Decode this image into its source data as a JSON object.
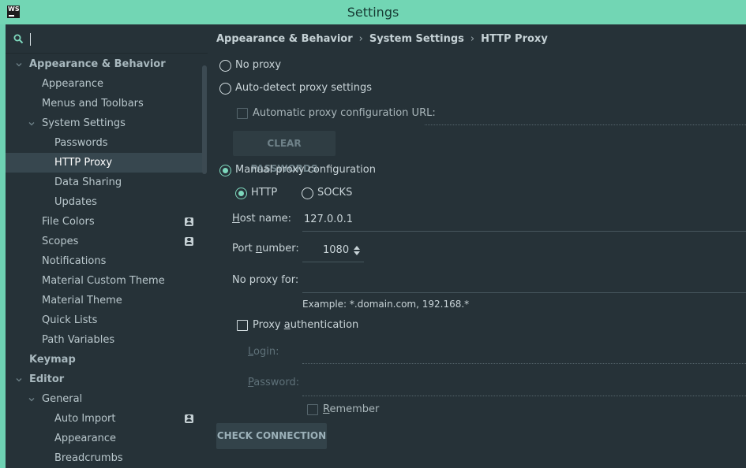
{
  "window": {
    "app_icon_text": "WS",
    "title": "Settings"
  },
  "sidebar": {
    "search": {
      "value": "",
      "placeholder": ""
    },
    "items": [
      {
        "label": "Appearance & Behavior",
        "level": 0,
        "expanded": true,
        "bold": true
      },
      {
        "label": "Appearance",
        "level": 1
      },
      {
        "label": "Menus and Toolbars",
        "level": 1
      },
      {
        "label": "System Settings",
        "level": 1,
        "expanded": true
      },
      {
        "label": "Passwords",
        "level": 2
      },
      {
        "label": "HTTP Proxy",
        "level": 2,
        "selected": true
      },
      {
        "label": "Data Sharing",
        "level": 2
      },
      {
        "label": "Updates",
        "level": 2
      },
      {
        "label": "File Colors",
        "level": 1,
        "project_icon": true
      },
      {
        "label": "Scopes",
        "level": 1,
        "project_icon": true
      },
      {
        "label": "Notifications",
        "level": 1
      },
      {
        "label": "Material Custom Theme",
        "level": 1
      },
      {
        "label": "Material Theme",
        "level": 1
      },
      {
        "label": "Quick Lists",
        "level": 1
      },
      {
        "label": "Path Variables",
        "level": 1
      },
      {
        "label": "Keymap",
        "level": 0,
        "bold": true
      },
      {
        "label": "Editor",
        "level": 0,
        "expanded": true,
        "bold": true
      },
      {
        "label": "General",
        "level": 1,
        "expanded": true
      },
      {
        "label": "Auto Import",
        "level": 2,
        "project_icon": true
      },
      {
        "label": "Appearance",
        "level": 2
      },
      {
        "label": "Breadcrumbs",
        "level": 2
      }
    ]
  },
  "breadcrumb": {
    "part1": "Appearance & Behavior",
    "sep1": "›",
    "part2": "System Settings",
    "sep2": "›",
    "part3": "HTTP Proxy"
  },
  "proxy": {
    "no_proxy_label": "No proxy",
    "auto_detect_label": "Auto-detect proxy settings",
    "auto_config_url_label": "Automatic proxy configuration URL:",
    "auto_config_url_value": "",
    "clear_passwords_button": "CLEAR PASSWORDS",
    "manual_label": "Manual proxy configuration",
    "selected_mode": "manual",
    "http_label": "HTTP",
    "socks_label": "SOCKS",
    "selected_protocol": "HTTP",
    "host_label_prefix": "",
    "host_label_u": "H",
    "host_label_rest": "ost name:",
    "host_value": "127.0.0.1",
    "port_label_prefix": "Port ",
    "port_label_u": "n",
    "port_label_rest": "umber:",
    "port_value": "1080",
    "no_proxy_for_label": "No proxy for:",
    "no_proxy_for_value": "",
    "example_text": "Example: *.domain.com, 192.168.*",
    "auth_label_prefix": "Proxy ",
    "auth_label_u": "a",
    "auth_label_rest": "uthentication",
    "login_label_u": "L",
    "login_label_rest": "ogin:",
    "password_label_u": "P",
    "password_label_rest": "assword:",
    "remember_label_u": "R",
    "remember_label_rest": "emember",
    "check_connection_button": "CHECK CONNECTION"
  },
  "colors": {
    "accent": "#7ed8bd",
    "background": "#263238",
    "selection": "#37474f",
    "titlebar": "#72d6b4"
  }
}
